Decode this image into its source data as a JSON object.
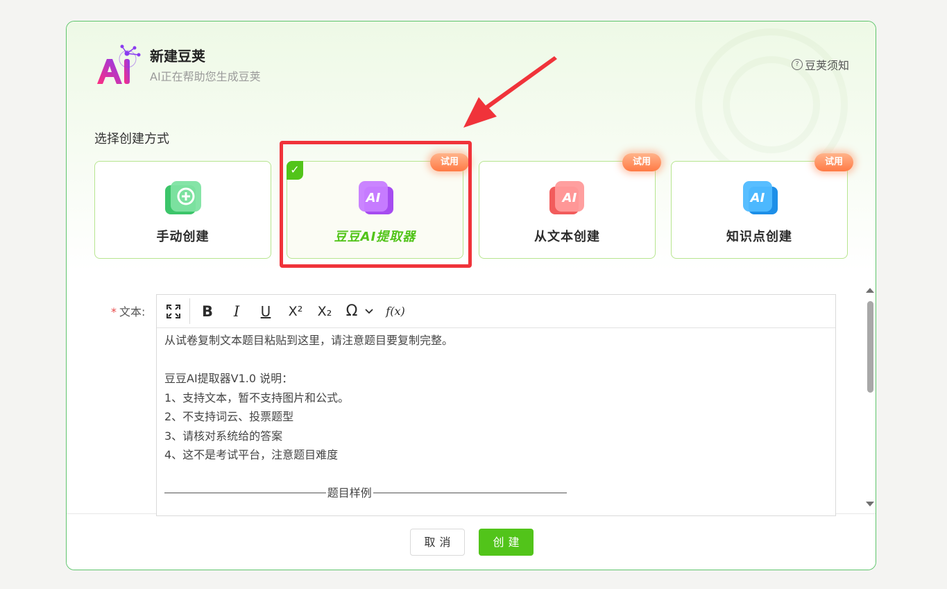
{
  "dialog": {
    "title": "新建豆荚",
    "subtitle": "AI正在帮助您生成豆荚",
    "help_icon": "question-circle-icon",
    "help_label": "豆荚须知"
  },
  "creation": {
    "section_label": "选择创建方式",
    "trial_badge": "试用",
    "cards": [
      {
        "label": "手动创建",
        "icon": "plus-folder-icon",
        "selected": false,
        "trial": false
      },
      {
        "label": "豆豆AI提取器",
        "icon": "ai-purple-icon",
        "selected": true,
        "trial": true
      },
      {
        "label": "从文本创建",
        "icon": "ai-red-icon",
        "selected": false,
        "trial": true
      },
      {
        "label": "知识点创建",
        "icon": "ai-blue-icon",
        "selected": false,
        "trial": true
      }
    ]
  },
  "form": {
    "required_mark": "*",
    "text_label": "文本:",
    "toolbar": {
      "fullscreen": "fullscreen-icon",
      "bold": "B",
      "italic": "I",
      "underline": "U",
      "superscript": "X²",
      "subscript": "X₂",
      "special_char": "Ω",
      "formula": "f(x)"
    },
    "editor_lines": [
      "从试卷复制文本题目粘贴到这里，请注意题目要复制完整。",
      "",
      "豆豆AI提取器V1.0 说明：",
      "1、支持文本，暂不支持图片和公式。",
      "2、不支持词云、投票题型",
      "3、请核对系统给的答案",
      "4、这不是考试平台，注意题目难度",
      ""
    ],
    "sample_label": "题目样例"
  },
  "footer": {
    "cancel_label": "取消",
    "create_label": "创建"
  },
  "colors": {
    "accent_green": "#52c41a",
    "highlight_red": "#f0333a",
    "trial_orange": "#ff7a45"
  }
}
